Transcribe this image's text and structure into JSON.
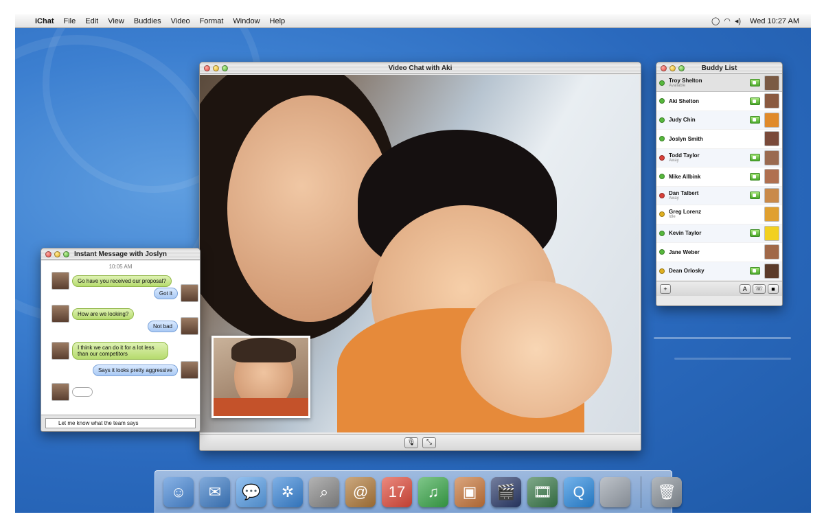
{
  "menubar": {
    "app_name": "iChat",
    "items": [
      "File",
      "Edit",
      "View",
      "Buddies",
      "Video",
      "Format",
      "Window",
      "Help"
    ],
    "clock": "Wed 10:27 AM"
  },
  "video_chat": {
    "title": "Video Chat with Aki",
    "mute_icon": "🎙",
    "fullscreen_icon": "⤡"
  },
  "im": {
    "title": "Instant Message with Joslyn",
    "timestamp": "10:05 AM",
    "messages": [
      "Go have you received our proposal?",
      "Got it",
      "How are we looking?",
      "Not bad",
      "I think we can do it for a lot less than our competitors",
      "Says it looks pretty aggressive",
      ""
    ],
    "input_value": "Let me know what the team says"
  },
  "buddy_list": {
    "title": "Buddy List",
    "me": {
      "name": "Troy Shelton",
      "status": "Available"
    },
    "buddies": [
      {
        "name": "Aki Shelton",
        "sub": "",
        "status_color": "#56b83c",
        "video": true,
        "pic_color": "#8a5a40"
      },
      {
        "name": "Judy Chin",
        "sub": "",
        "status_color": "#56b83c",
        "video": true,
        "pic_color": "#e08a2a"
      },
      {
        "name": "Joslyn Smith",
        "sub": "",
        "status_color": "#56b83c",
        "video": false,
        "pic_color": "#7a4a3a"
      },
      {
        "name": "Todd Taylor",
        "sub": "Away",
        "status_color": "#d8403a",
        "video": true,
        "pic_color": "#9a6a50"
      },
      {
        "name": "Mike Allbink",
        "sub": "",
        "status_color": "#56b83c",
        "video": true,
        "pic_color": "#b07050"
      },
      {
        "name": "Dan Talbert",
        "sub": "Away",
        "status_color": "#d8403a",
        "video": true,
        "pic_color": "#c98a4a"
      },
      {
        "name": "Greg Lorenz",
        "sub": "Idle",
        "status_color": "#e0b020",
        "video": false,
        "pic_color": "#e0a030"
      },
      {
        "name": "Kevin Taylor",
        "sub": "",
        "status_color": "#56b83c",
        "video": true,
        "pic_color": "#f2d020"
      },
      {
        "name": "Jane Weber",
        "sub": "",
        "status_color": "#56b83c",
        "video": false,
        "pic_color": "#a06848"
      },
      {
        "name": "Dean Orlosky",
        "sub": "",
        "status_color": "#e0b020",
        "video": true,
        "pic_color": "#5a3a2a"
      }
    ],
    "add_button": "+",
    "text_button": "A",
    "audio_button": "☏",
    "video_button": "■"
  },
  "dock": {
    "apps": [
      {
        "name": "finder-icon",
        "glyph": "☺",
        "color": "#4a8ad8"
      },
      {
        "name": "mail-icon",
        "glyph": "✉",
        "color": "#3f7ec8"
      },
      {
        "name": "ichat-icon",
        "glyph": "💬",
        "color": "#5aa0e8"
      },
      {
        "name": "safari-icon",
        "glyph": "✲",
        "color": "#3a86d8"
      },
      {
        "name": "sherlock-icon",
        "glyph": "⌕",
        "color": "#8a8a8a"
      },
      {
        "name": "address-book-icon",
        "glyph": "@",
        "color": "#b07a3a"
      },
      {
        "name": "ical-icon",
        "glyph": "17",
        "color": "#e04a3a"
      },
      {
        "name": "itunes-icon",
        "glyph": "♫",
        "color": "#3aa84a"
      },
      {
        "name": "iphoto-icon",
        "glyph": "▣",
        "color": "#c8763a"
      },
      {
        "name": "imovie-icon",
        "glyph": "🎬",
        "color": "#2a3a6a"
      },
      {
        "name": "idvd-icon",
        "glyph": "🎞",
        "color": "#3a7a4a"
      },
      {
        "name": "quicktime-icon",
        "glyph": "Q",
        "color": "#2a8ae0"
      },
      {
        "name": "system-preferences-icon",
        "glyph": "",
        "color": "#9aa2ac"
      }
    ],
    "trash": {
      "name": "trash-icon",
      "glyph": "🗑",
      "color": "#8a929a"
    }
  },
  "colors": {
    "desktop": "#2a69bd",
    "im_green_bubble": "#b6db6e",
    "im_blue_bubble": "#a9c9f4"
  }
}
